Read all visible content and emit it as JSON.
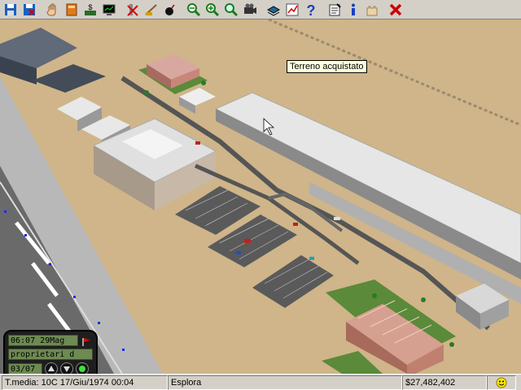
{
  "toolbar": {
    "buttons": [
      {
        "icon": "save-icon"
      },
      {
        "icon": "save-as-icon"
      },
      {
        "icon": "hand-icon"
      },
      {
        "icon": "book-icon"
      },
      {
        "icon": "finance-icon"
      },
      {
        "icon": "monitor-icon"
      },
      {
        "icon": "demolish-icon"
      },
      {
        "icon": "bulldoze-icon"
      },
      {
        "icon": "bomb-icon"
      },
      {
        "icon": "zoom-out-icon"
      },
      {
        "icon": "zoom-in-icon"
      },
      {
        "icon": "zoom-tool-icon"
      },
      {
        "icon": "camera-icon"
      },
      {
        "icon": "layers-icon"
      },
      {
        "icon": "graph-icon"
      },
      {
        "icon": "help-icon"
      },
      {
        "icon": "notepad-icon"
      },
      {
        "icon": "info-icon"
      },
      {
        "icon": "castle-icon"
      },
      {
        "icon": "close-icon"
      }
    ],
    "colors": {
      "close": "#cc0000",
      "help": "#1a3fc0",
      "info": "#1a3fc0"
    }
  },
  "tooltip": {
    "text": "Terreno acquistato"
  },
  "clock_panel": {
    "time_date": "06:07 29Mag",
    "message": "proprietari d",
    "counter": "03/07"
  },
  "status_bar": {
    "temperature_date": "T.media: 10C  17/Giu/1974 00:04",
    "mode": "Esplora",
    "money": "$27,482,402",
    "smiley": "smiley-icon"
  }
}
